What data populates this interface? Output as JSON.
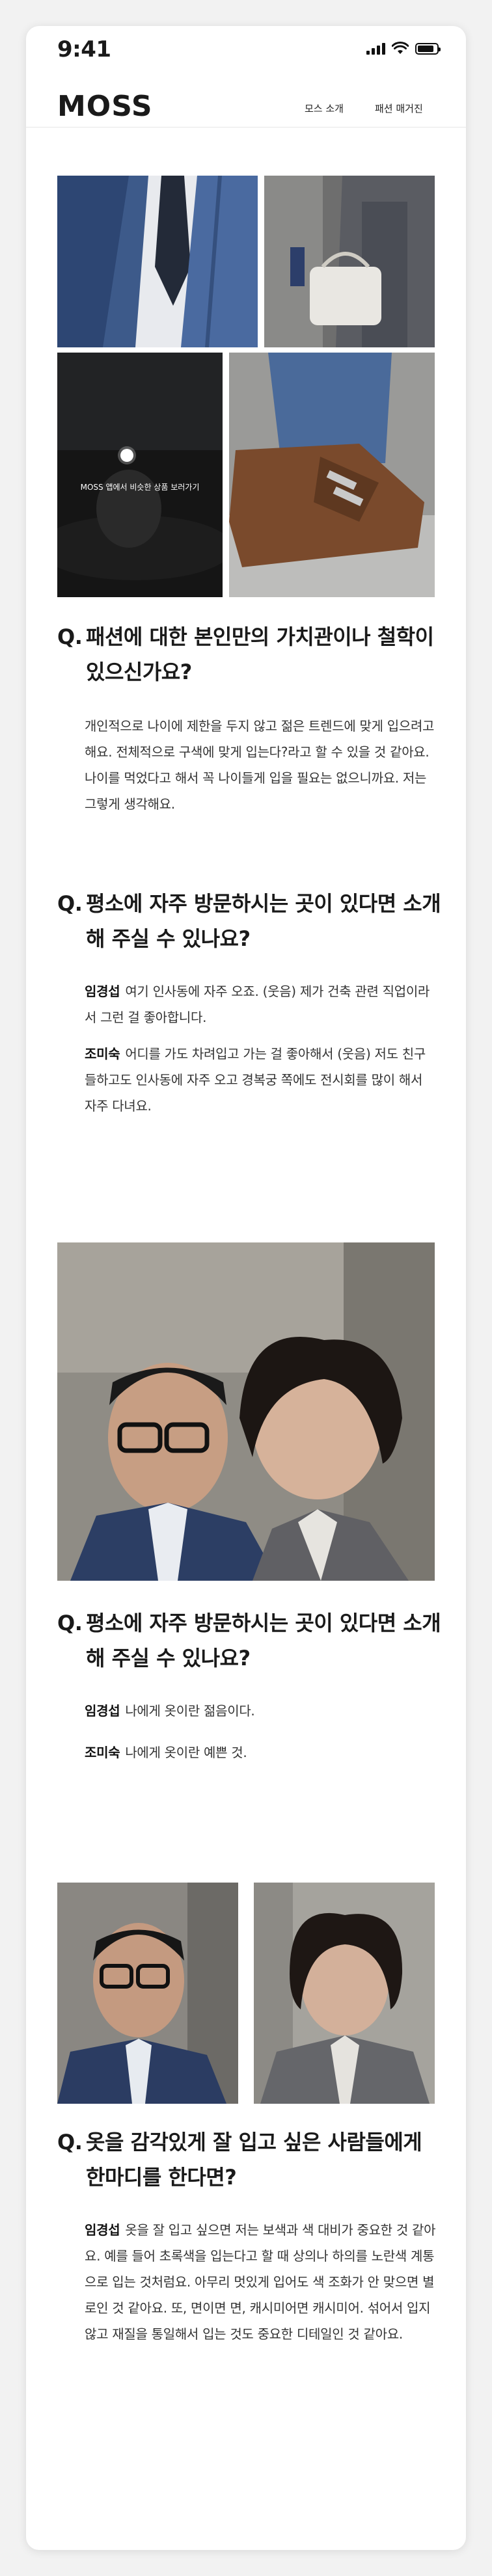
{
  "status": {
    "time": "9:41"
  },
  "nav": {
    "logo": "MOSS",
    "links": [
      "모스 소개",
      "패션 매거진"
    ]
  },
  "gallery": {
    "pin_text": "MOSS 앱에서 비슷한 상품 보러가기"
  },
  "sections": [
    {
      "question": "패션에 대한 본인만의 가치관이나 철학이 있으신가요?",
      "answers": [
        {
          "speaker": "",
          "text": "개인적으로 나이에 제한을 두지 않고 젊은 트렌드에 맞게 입으려고 해요. 전체적으로 구색에 맞게 입는다?라고 할 수 있을 것 같아요. 나이를 먹었다고 해서 꼭 나이들게 입을 필요는 없으니까요. 저는 그렇게 생각해요."
        }
      ]
    },
    {
      "question": "평소에 자주 방문하시는 곳이 있다면 소개해 주실 수 있나요?",
      "answers": [
        {
          "speaker": "임경섭",
          "text": "여기 인사동에 자주 오죠. (웃음) 제가 건축 관련 직업이라서 그런 걸 좋아합니다."
        },
        {
          "speaker": "조미숙",
          "text": "어디를 가도 차려입고 가는 걸 좋아해서 (웃음) 저도 친구들하고도 인사동에 자주 오고 경복궁 쪽에도 전시회를 많이 해서 자주 다녀요."
        }
      ]
    },
    {
      "question": "평소에 자주 방문하시는 곳이 있다면 소개해 주실 수 있나요?",
      "answers": [
        {
          "speaker": "임경섭",
          "text": "나에게 옷이란 젊음이다."
        },
        {
          "speaker": "조미숙",
          "text": "나에게 옷이란 예쁜 것."
        }
      ]
    },
    {
      "question": "옷을 감각있게 잘 입고 싶은 사람들에게 한마디를 한다면?",
      "answers": [
        {
          "speaker": "임경섭",
          "text": "옷을 잘 입고 싶으면 저는 보색과 색 대비가 중요한 것 같아요. 예를 들어 초록색을 입는다고 할 때 상의나 하의를 노란색 계통으로 입는 것처럼요. 아무리 멋있게 입어도 색 조화가 안 맞으면 별로인 것 같아요. 또, 면이면 면, 캐시미어면 캐시미어. 섞어서 입지 않고 재질을 통일해서 입는 것도 중요한 디테일인 것 같아요."
        }
      ]
    }
  ],
  "colors": {
    "background": "#ffffff",
    "text": "#1a1a1a",
    "frame": "#f2f2f2"
  }
}
